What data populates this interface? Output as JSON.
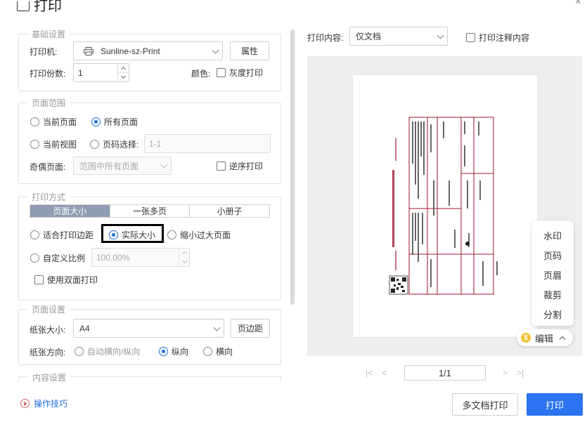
{
  "dialog": {
    "title": "打印",
    "close_glyph": "×"
  },
  "basic": {
    "legend": "基础设置",
    "printer_label": "打印机:",
    "printer_value": "Sunline-sz-Print",
    "properties_button": "属性",
    "copies_label": "打印份数:",
    "copies_value": "1",
    "color_label": "颜色:",
    "grayscale_label": "灰度打印",
    "grayscale_checked": false
  },
  "range": {
    "legend": "页面范围",
    "options": [
      "当前页面",
      "所有页面",
      "当前视图",
      "页码选择:"
    ],
    "selected": "所有页面",
    "page_input_placeholder": "1-1",
    "odd_even_label": "奇偶页面:",
    "odd_even_value": "范围中所有页面",
    "reverse_label": "逆序打印"
  },
  "mode": {
    "legend": "打印方式",
    "tabs": [
      "页面大小",
      "一张多页",
      "小册子"
    ],
    "active_tab": "页面大小",
    "fit_margin": "适合打印边距",
    "actual_size": "实际大小",
    "shrink_large": "缩小过大页面",
    "custom_scale": "自定义比例",
    "scale_value": "100.00%",
    "duplex_label": "使用双面打印",
    "selected": "实际大小"
  },
  "paper": {
    "legend": "页面设置",
    "size_label": "纸张大小:",
    "size_value": "A4",
    "margin_button": "页边距",
    "orientation_label": "纸张方向:",
    "orientation_options": [
      "自动横向/纵向",
      "纵向",
      "横向"
    ],
    "orientation_selected": "纵向"
  },
  "content_section": {
    "legend": "内容设置"
  },
  "preview": {
    "content_label": "打印内容:",
    "content_value": "仅文档",
    "annotations_label": "打印注释内容",
    "page_indicator": "1/1",
    "nav_first": "|<",
    "nav_prev": "<",
    "nav_next": ">",
    "nav_last": ">|"
  },
  "side_menu": {
    "items": [
      "水印",
      "页码",
      "页眉",
      "裁剪",
      "分割"
    ],
    "edit_label": "编辑"
  },
  "footer": {
    "tips_label": "操作技巧",
    "multi_print": "多文档打印",
    "print": "打印"
  },
  "colors": {
    "accent": "#2b73f0",
    "tab_active": "#8f9db3",
    "invoice_red": "#a3142d"
  }
}
